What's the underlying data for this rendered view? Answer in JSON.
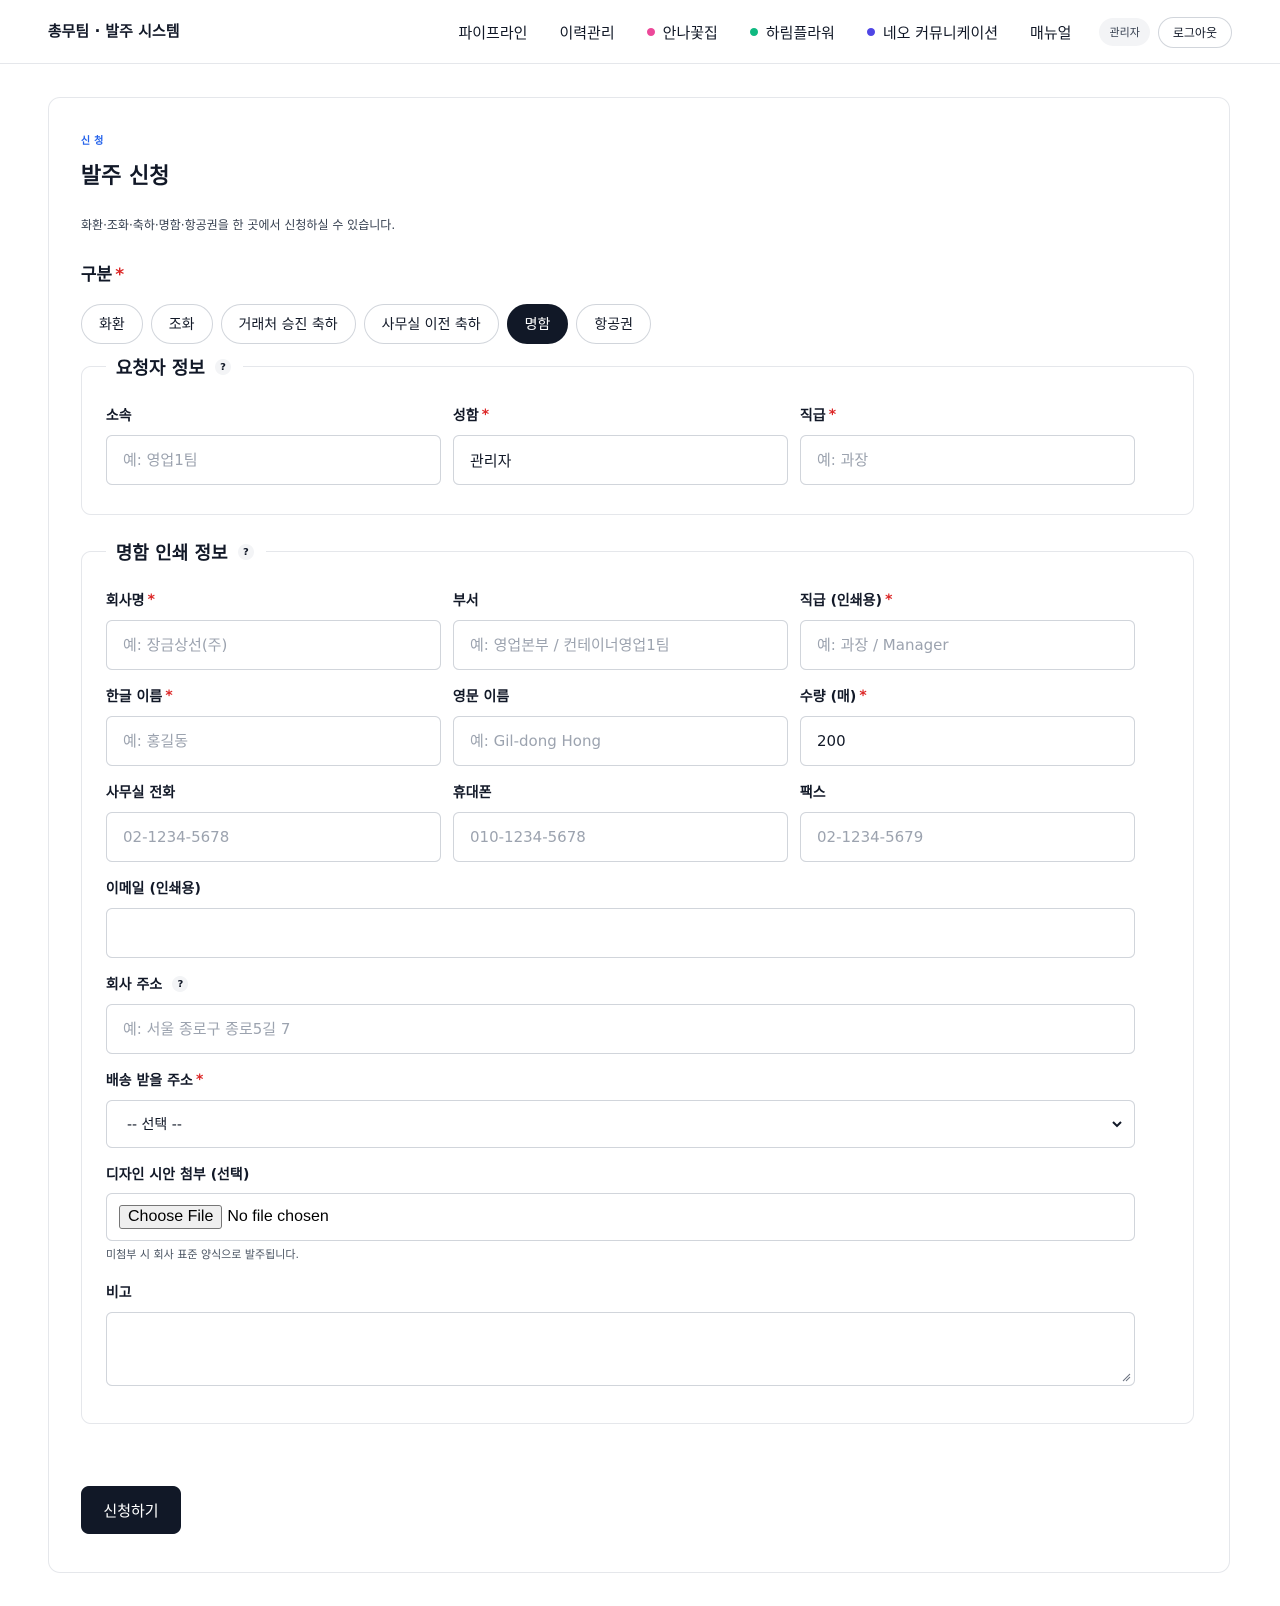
{
  "header": {
    "brand": "총무팀 · 발주 시스템",
    "nav": [
      {
        "label": "파이프라인",
        "dot": null
      },
      {
        "label": "이력관리",
        "dot": null
      },
      {
        "label": "안나꽃집",
        "dot": "#ec4899"
      },
      {
        "label": "하림플라워",
        "dot": "#10b981"
      },
      {
        "label": "네오 커뮤니케이션",
        "dot": "#4f46e5"
      },
      {
        "label": "매뉴얼",
        "dot": null
      }
    ],
    "role_badge": "관리자",
    "logout_label": "로그아웃"
  },
  "form": {
    "kicker": "신청",
    "title": "발주 신청",
    "description": "화환·조화·축하·명함·항공권을 한 곳에서 신청하실 수 있습니다.",
    "category_label": "구분",
    "required_mark": "*",
    "categories": [
      "화환",
      "조화",
      "거래처 승진 축하",
      "사무실 이전 축하",
      "명함",
      "항공권"
    ],
    "selected_category": "명함",
    "requester": {
      "legend": "요청자 정보",
      "help": "?",
      "fields": [
        {
          "label": "소속",
          "required": false,
          "value": "",
          "placeholder": "예: 영업1팀"
        },
        {
          "label": "성함",
          "required": true,
          "value": "관리자",
          "placeholder": ""
        },
        {
          "label": "직급",
          "required": true,
          "value": "",
          "placeholder": "예: 과장"
        }
      ]
    },
    "card_info": {
      "legend": "명함 인쇄 정보",
      "help": "?",
      "company": {
        "label": "회사명",
        "required": true,
        "value": "",
        "placeholder": "예: 장금상선(주)"
      },
      "department": {
        "label": "부서",
        "required": false,
        "value": "",
        "placeholder": "예: 영업본부 / 컨테이너영업1팀"
      },
      "position": {
        "label": "직급 (인쇄용)",
        "required": true,
        "value": "",
        "placeholder": "예: 과장 / Manager"
      },
      "korean_name": {
        "label": "한글 이름",
        "required": true,
        "value": "",
        "placeholder": "예: 홍길동"
      },
      "english_name": {
        "label": "영문 이름",
        "required": false,
        "value": "",
        "placeholder": "예: Gil-dong Hong"
      },
      "quantity": {
        "label": "수량 (매)",
        "required": true,
        "value": "200",
        "placeholder": ""
      },
      "office_phone": {
        "label": "사무실 전화",
        "required": false,
        "value": "",
        "placeholder": "02-1234-5678"
      },
      "mobile": {
        "label": "휴대폰",
        "required": false,
        "value": "",
        "placeholder": "010-1234-5678"
      },
      "fax": {
        "label": "팩스",
        "required": false,
        "value": "",
        "placeholder": "02-1234-5679"
      },
      "email": {
        "label": "이메일 (인쇄용)",
        "required": false,
        "value": "",
        "placeholder": ""
      },
      "address": {
        "label": "회사 주소",
        "help": "?",
        "value": "",
        "placeholder": "예: 서울 종로구 종로5길 7"
      },
      "shipping": {
        "label": "배송 받을 주소",
        "required": true,
        "selected": "-- 선택 --"
      },
      "design": {
        "label": "디자인 시안 첨부 (선택)",
        "button": "Choose File",
        "status": "No file chosen",
        "hint": "미첨부 시 회사 표준 양식으로 발주됩니다."
      },
      "notes": {
        "label": "비고",
        "value": ""
      }
    },
    "submit_label": "신청하기"
  }
}
